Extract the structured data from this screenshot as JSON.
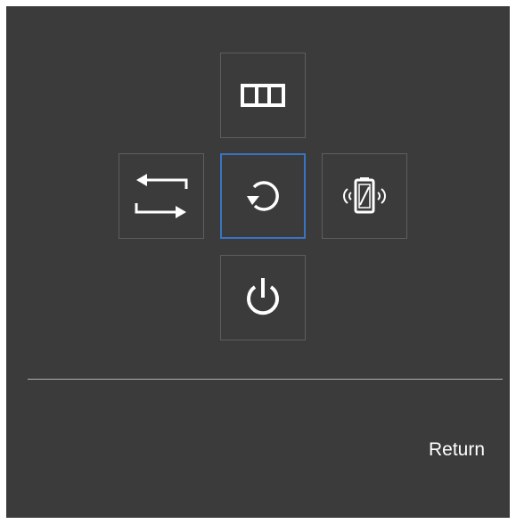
{
  "menu": {
    "up": {
      "icon": "picture-mode-icon"
    },
    "left": {
      "icon": "source-switch-icon"
    },
    "center": {
      "icon": "return-icon",
      "selected": true
    },
    "right": {
      "icon": "eco-battery-icon"
    },
    "down": {
      "icon": "power-icon"
    }
  },
  "footer": {
    "label": "Return"
  },
  "colors": {
    "background": "#3b3b3b",
    "tile_border": "#5e5e5e",
    "selected_border": "#3a73c4",
    "icon": "#ffffff",
    "divider": "#b0b0b0"
  }
}
